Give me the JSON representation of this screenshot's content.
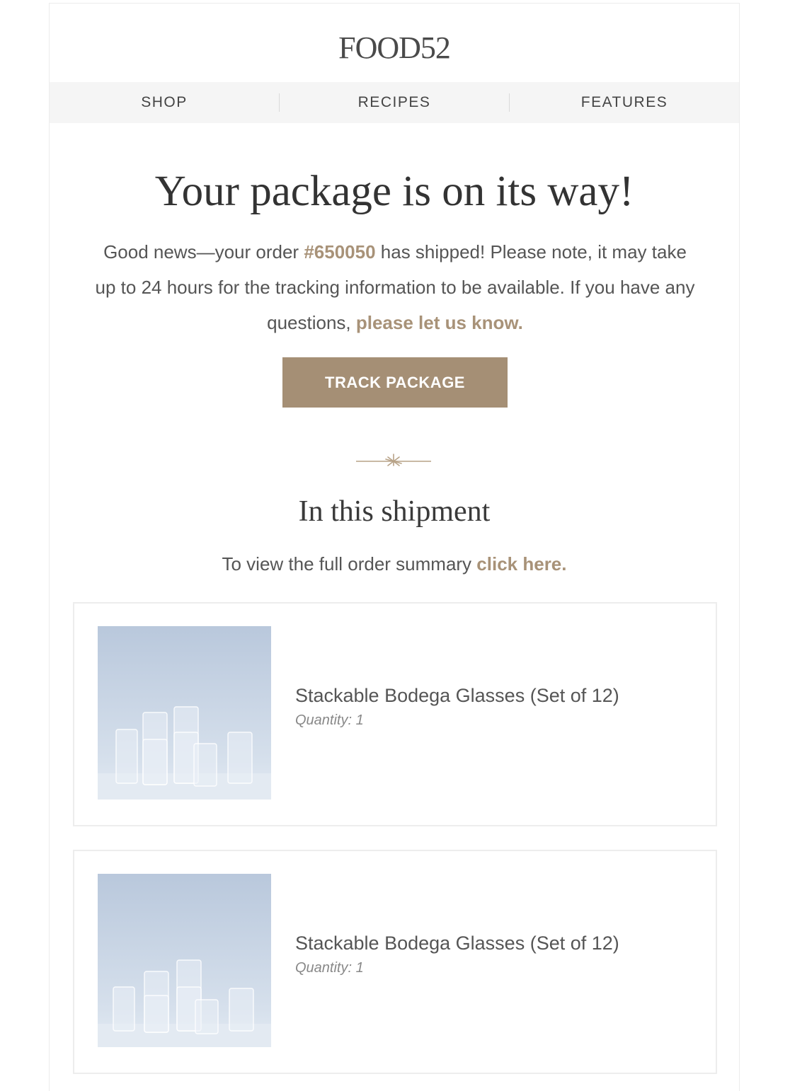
{
  "brand": {
    "logo_text": "FOOD52"
  },
  "nav": {
    "items": [
      {
        "label": "SHOP"
      },
      {
        "label": "RECIPES"
      },
      {
        "label": "FEATURES"
      }
    ]
  },
  "hero": {
    "headline": "Your package is on its way!",
    "intro_part1": "Good news—your order ",
    "order_number": "#650050",
    "intro_part2": " has shipped! Please note, it may take up to 24 hours for the tracking information to be available. If you have any questions, ",
    "contact_link": "please let us know.",
    "track_button": "TRACK PACKAGE"
  },
  "shipment": {
    "title": "In this shipment",
    "summary_text": "To view the full order summary ",
    "summary_link": "click here.",
    "items": [
      {
        "name": "Stackable Bodega Glasses (Set of 12)",
        "quantity": "Quantity: 1"
      },
      {
        "name": "Stackable Bodega Glasses (Set of 12)",
        "quantity": "Quantity: 1"
      }
    ]
  },
  "colors": {
    "accent": "#a58f75",
    "nav_bg": "#f5f5f5",
    "text": "#555555",
    "heading": "#333333"
  }
}
